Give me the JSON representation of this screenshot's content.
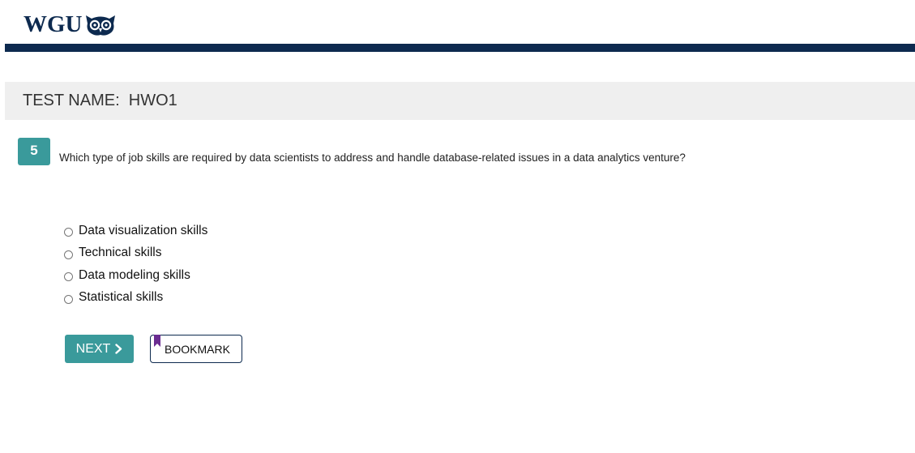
{
  "header": {
    "logo_text": "WGU",
    "logo_icon": "owl-icon",
    "brand_color": "#0d2a4f"
  },
  "test": {
    "label": "TEST NAME:  HWO1"
  },
  "question": {
    "number": "5",
    "text": "Which type of job skills are required by data scientists to address and handle database-related issues in a data analytics venture?",
    "accent_color": "#3a9a9b"
  },
  "options": [
    {
      "label": "Data visualization skills",
      "selected": false
    },
    {
      "label": "Technical skills",
      "selected": false
    },
    {
      "label": "Data modeling skills",
      "selected": false
    },
    {
      "label": "Statistical skills",
      "selected": false
    }
  ],
  "buttons": {
    "next_label": "NEXT",
    "next_icon": "chevron-right-icon",
    "bookmark_label": "BOOKMARK",
    "bookmark_icon": "bookmark-icon",
    "bookmark_icon_color": "#6a2c91"
  }
}
